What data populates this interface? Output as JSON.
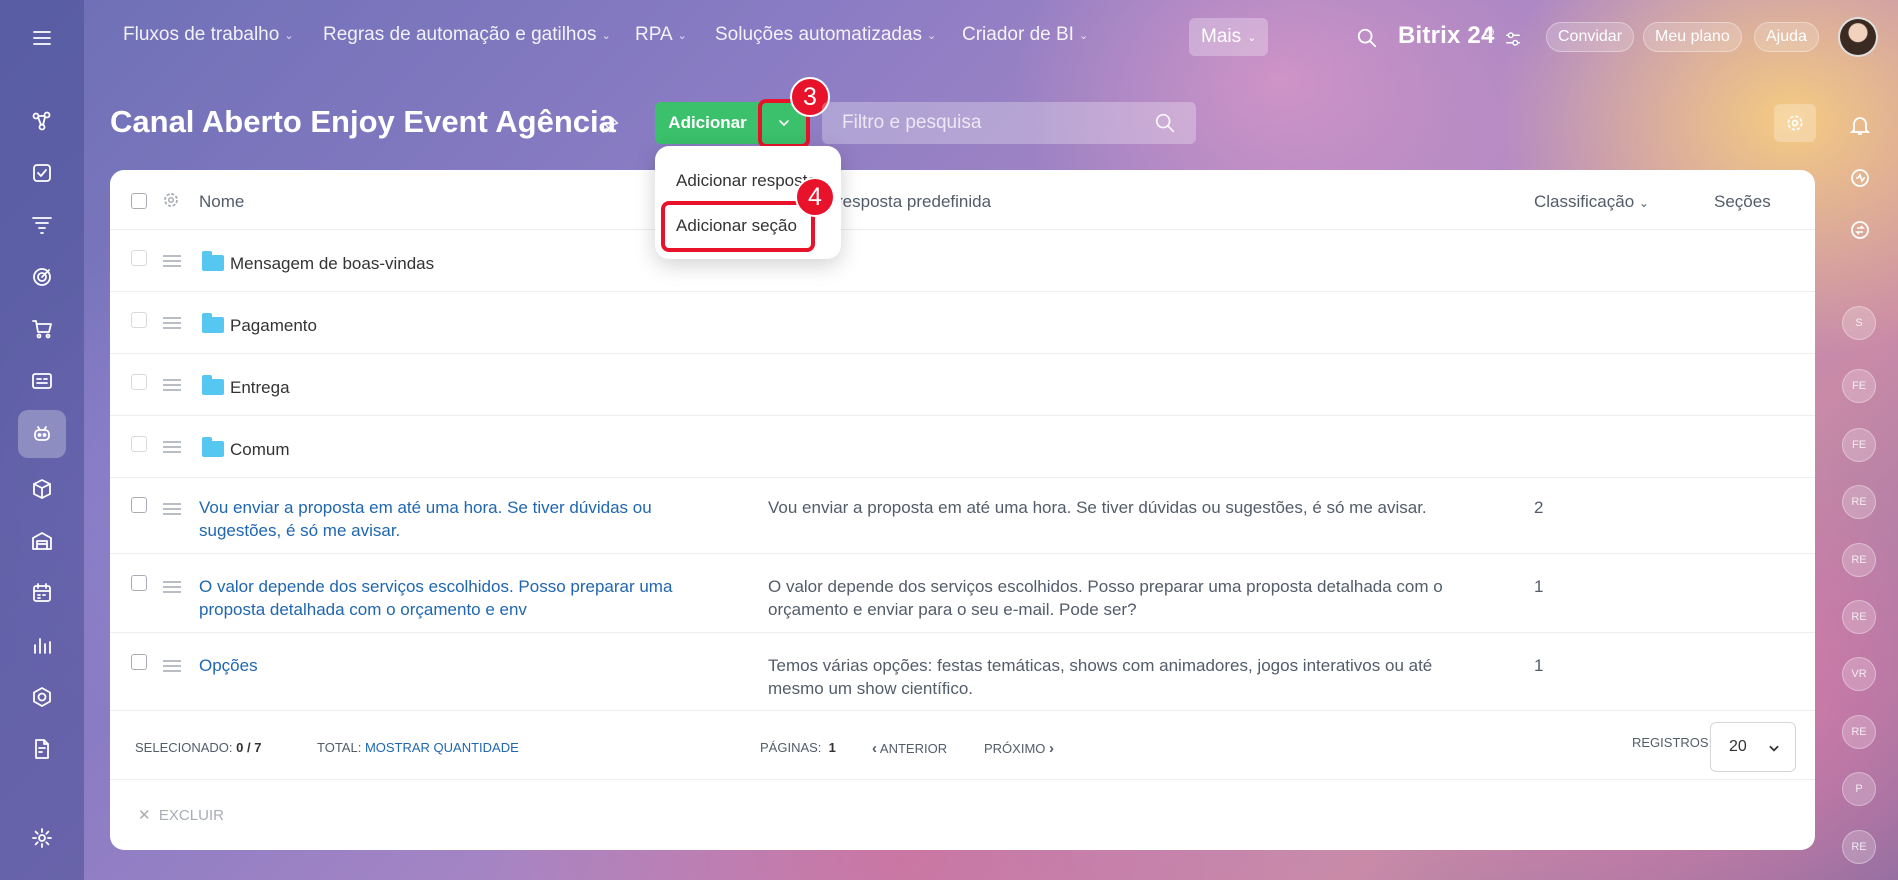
{
  "topnav": {
    "items": [
      {
        "label": "Fluxos de trabalho"
      },
      {
        "label": "Regras de automação e gatilhos"
      },
      {
        "label": "RPA"
      },
      {
        "label": "Soluções automatizadas"
      },
      {
        "label": "Criador de BI"
      }
    ],
    "more": "Mais",
    "brand": "Bitrix 24",
    "invite": "Convidar",
    "plan": "Meu plano",
    "help": "Ajuda"
  },
  "page": {
    "title": "Canal Aberto Enjoy Event Agência",
    "add_label": "Adicionar",
    "search_placeholder": "Filtro e pesquisa"
  },
  "annotations": {
    "step3": "3",
    "step4": "4"
  },
  "dropdown": {
    "item1": "Adicionar resposta",
    "item2": "Adicionar seção"
  },
  "table": {
    "headers": {
      "name": "Nome",
      "answer": "resposta predefinida",
      "sort": "Classificação",
      "sections": "Seções"
    },
    "folders": [
      "Mensagem de boas-vindas",
      "Pagamento",
      "Entrega",
      "Comum"
    ],
    "rows": [
      {
        "name": "Vou enviar a proposta em até uma hora. Se tiver dúvidas ou sugestões, é só me avisar.",
        "answer": "Vou enviar a proposta em até uma hora. Se tiver dúvidas ou sugestões, é só me avisar.",
        "sort": "2"
      },
      {
        "name": "O valor depende dos serviços escolhidos. Posso preparar uma proposta detalhada com o orçamento e env",
        "answer": "O valor depende dos serviços escolhidos. Posso preparar uma proposta detalhada com o orçamento e enviar para o seu e-mail. Pode ser?",
        "sort": "1"
      },
      {
        "name": "Opções",
        "answer": "Temos várias opções: festas temáticas, shows com animadores, jogos interativos ou até mesmo um show científico.",
        "sort": "1"
      }
    ]
  },
  "footer": {
    "selected_label": "SELECIONADO:",
    "selected_value": "0 / 7",
    "total_label": "TOTAL:",
    "total_value": "MOSTRAR QUANTIDADE",
    "pages_label": "PÁGINAS:",
    "pages_value": "1",
    "prev": "ANTERIOR",
    "next": "PRÓXIMO",
    "records_label": "REGISTROS:",
    "records_value": "20",
    "delete": "EXCLUIR"
  },
  "right_rail": {
    "avatars": [
      "S",
      "FE",
      "FE",
      "RE",
      "RE",
      "RE",
      "VR",
      "RE",
      "P",
      "RE"
    ]
  }
}
